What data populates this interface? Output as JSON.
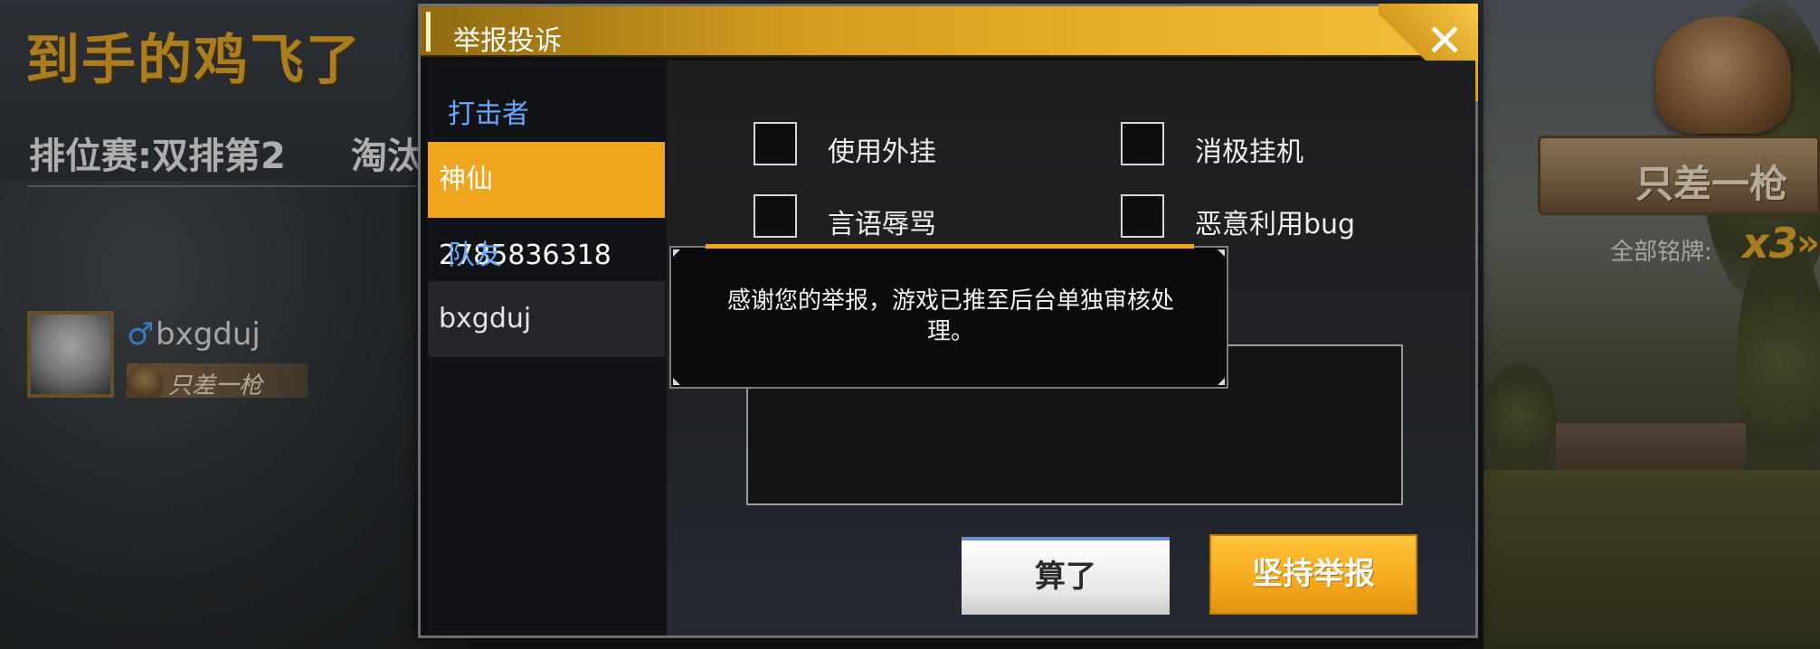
{
  "background": {
    "result_title": "到手的鸡飞了",
    "rank_text": "排位赛:双排第2",
    "rank_text_2": "淘汰",
    "player": {
      "gender_symbol": "♂",
      "name": "bxgduj",
      "badge": "只差一枪"
    },
    "award": {
      "title": "只差一枪",
      "count_label": "全部铭牌:",
      "count": "x3",
      "arrow": "»"
    }
  },
  "dialog": {
    "title": "举报投诉",
    "close_glyph": "✕",
    "sections": {
      "attacker_label": "打击者",
      "teammate_label": "队友"
    },
    "targets": [
      {
        "name": "神仙2785836318",
        "selected": true
      },
      {
        "name": "bxgduj",
        "selected": false
      }
    ],
    "options": [
      {
        "label": "使用外挂",
        "checked": false
      },
      {
        "label": "消极挂机",
        "checked": false
      },
      {
        "label": "言语辱骂",
        "checked": false
      },
      {
        "label": "恶意利用bug",
        "checked": false
      }
    ],
    "textbox_placeholder": "",
    "buttons": {
      "cancel": "算了",
      "confirm": "坚持举报"
    }
  },
  "toast": {
    "message": "感谢您的举报，游戏已推至后台单独审核处理。"
  },
  "colors": {
    "accent": "#f0a51f",
    "section_label": "#6aa8ff",
    "gold_title": "#e3a92b"
  }
}
